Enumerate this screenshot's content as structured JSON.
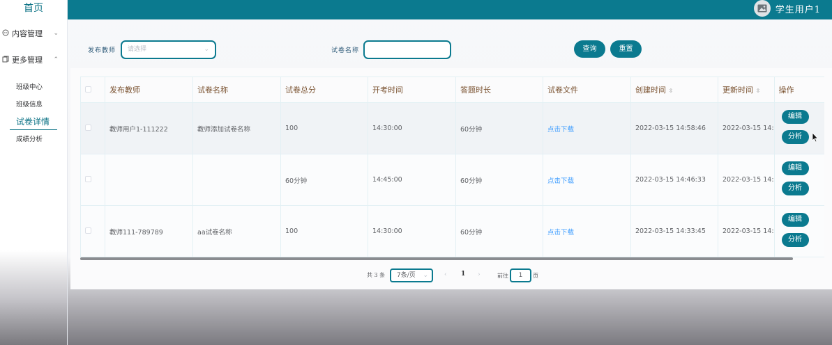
{
  "sidebar": {
    "home": "首页",
    "groups": [
      {
        "label": "内容管理",
        "icon": "chat-icon",
        "arrow": "⌄"
      },
      {
        "label": "更多管理",
        "icon": "copy-icon",
        "arrow": "⌃"
      }
    ],
    "items": [
      "班级中心",
      "班级信息",
      "试卷详情",
      "成绩分析"
    ],
    "active_item": "试卷详情"
  },
  "header": {
    "username": "学生用户1"
  },
  "search": {
    "teacher_label": "发布教师",
    "teacher_placeholder": "请选择",
    "paper_label": "试卷名称",
    "paper_value": "",
    "query_label": "查询",
    "reset_label": "重置"
  },
  "table": {
    "columns": [
      "发布教师",
      "试卷名称",
      "试卷总分",
      "开考时间",
      "答题时长",
      "试卷文件",
      "创建时间",
      "更新时间",
      "操作"
    ],
    "rows": [
      {
        "teacher": "教师用户1-111222",
        "paper": "教师添加试卷名称",
        "score": "100",
        "start": "14:30:00",
        "duration": "60分钟",
        "file": "点击下载",
        "created": "2022-03-15 14:58:46",
        "updated": "2022-03-15 14:"
      },
      {
        "teacher": "",
        "paper": "",
        "score": "60分钟",
        "start": "14:45:00",
        "duration": "60分钟",
        "file": "点击下载",
        "created": "2022-03-15 14:46:33",
        "updated": "2022-03-15 14:"
      },
      {
        "teacher": "教师111-789789",
        "paper": "aa试卷名称",
        "score": "100",
        "start": "14:30:00",
        "duration": "60分钟",
        "file": "点击下载",
        "created": "2022-03-15 14:33:45",
        "updated": "2022-03-15 14:"
      }
    ],
    "edit_label": "编辑",
    "analyze_label": "分析",
    "sort_icon": "⇳"
  },
  "pagination": {
    "total": "共 3 条",
    "page_size": "7条/页",
    "current_page": "1",
    "goto_prefix": "前往",
    "goto_value": "1",
    "goto_suffix": "页"
  }
}
